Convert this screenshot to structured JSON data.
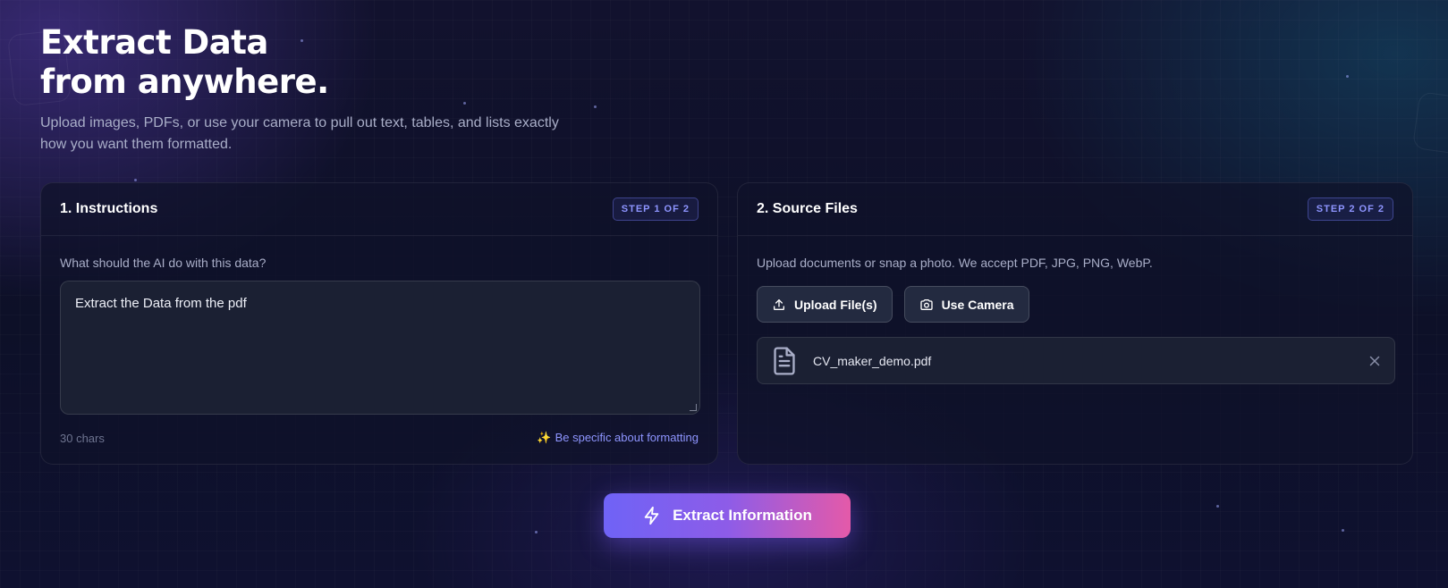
{
  "hero": {
    "title_line1": "Extract Data",
    "title_line2": "from anywhere.",
    "subtitle": "Upload images, PDFs, or use your camera to pull out text, tables, and lists exactly how you want them formatted."
  },
  "instructions": {
    "title": "1. Instructions",
    "step": "STEP 1 OF 2",
    "label": "What should the AI do with this data?",
    "value": "Extract the Data from the pdf",
    "char_count": "30 chars",
    "hint": "Be specific about formatting"
  },
  "source": {
    "title": "2. Source Files",
    "step": "STEP 2 OF 2",
    "description": "Upload documents or snap a photo. We accept PDF, JPG, PNG, WebP.",
    "upload_label": "Upload File(s)",
    "camera_label": "Use Camera",
    "files": [
      {
        "name": "CV_maker_demo.pdf",
        "icon": "file-text-icon"
      }
    ]
  },
  "actions": {
    "extract_label": "Extract Information"
  },
  "colors": {
    "accent": "#8e95ff",
    "gradient_start": "#6f63f6",
    "gradient_end": "#e45aa9"
  }
}
